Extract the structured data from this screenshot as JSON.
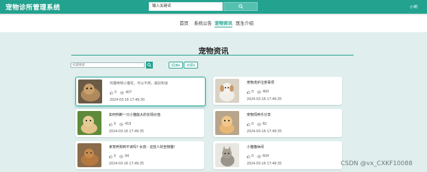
{
  "header": {
    "brand": "宠物诊所管理系统",
    "search_placeholder": "输入关键词",
    "user": "小明",
    "search_icon": "search-icon"
  },
  "nav": {
    "items": [
      {
        "label": "首页"
      },
      {
        "label": "系统公告"
      },
      {
        "label": "宠物资讯"
      },
      {
        "label": "医生介绍"
      }
    ],
    "active": "宠物资讯"
  },
  "page": {
    "title": "宠物资讯"
  },
  "filter": {
    "placeholder": "标题搜索",
    "sort1": "阅读▾",
    "sort2": "点赞▾"
  },
  "articles": [
    {
      "title": "鸡猫咪特小猫花，可以不用，最好知道",
      "likes": "0",
      "views": "407",
      "date": "2024-03-16 17:49:30"
    },
    {
      "title": "宠物洗护注意事项",
      "likes": "0",
      "views": "400",
      "date": "2024-03-16 17:49:35"
    },
    {
      "title": "如何判断一只小猫能大的长情价值",
      "likes": "0",
      "views": "419",
      "date": "2024-03-16 17:49:35"
    },
    {
      "title": "宠物饲养乐分享",
      "likes": "0",
      "views": "82",
      "date": "2024-03-16 17:49:35"
    },
    {
      "title": "家宠养狗到不该吗? 女孩：这些人好坐物猫!",
      "likes": "0",
      "views": "94",
      "date": "2024-03-16 17:49:35"
    },
    {
      "title": "小猫猫休闲",
      "likes": "0",
      "views": "604",
      "date": "2024-03-16 17:49:35"
    }
  ],
  "watermark": "CSDN @vx_CXKF10088",
  "colors": {
    "accent": "#22a28f",
    "header_bg": "#22a28f",
    "content_bg": "#e1eeee"
  }
}
